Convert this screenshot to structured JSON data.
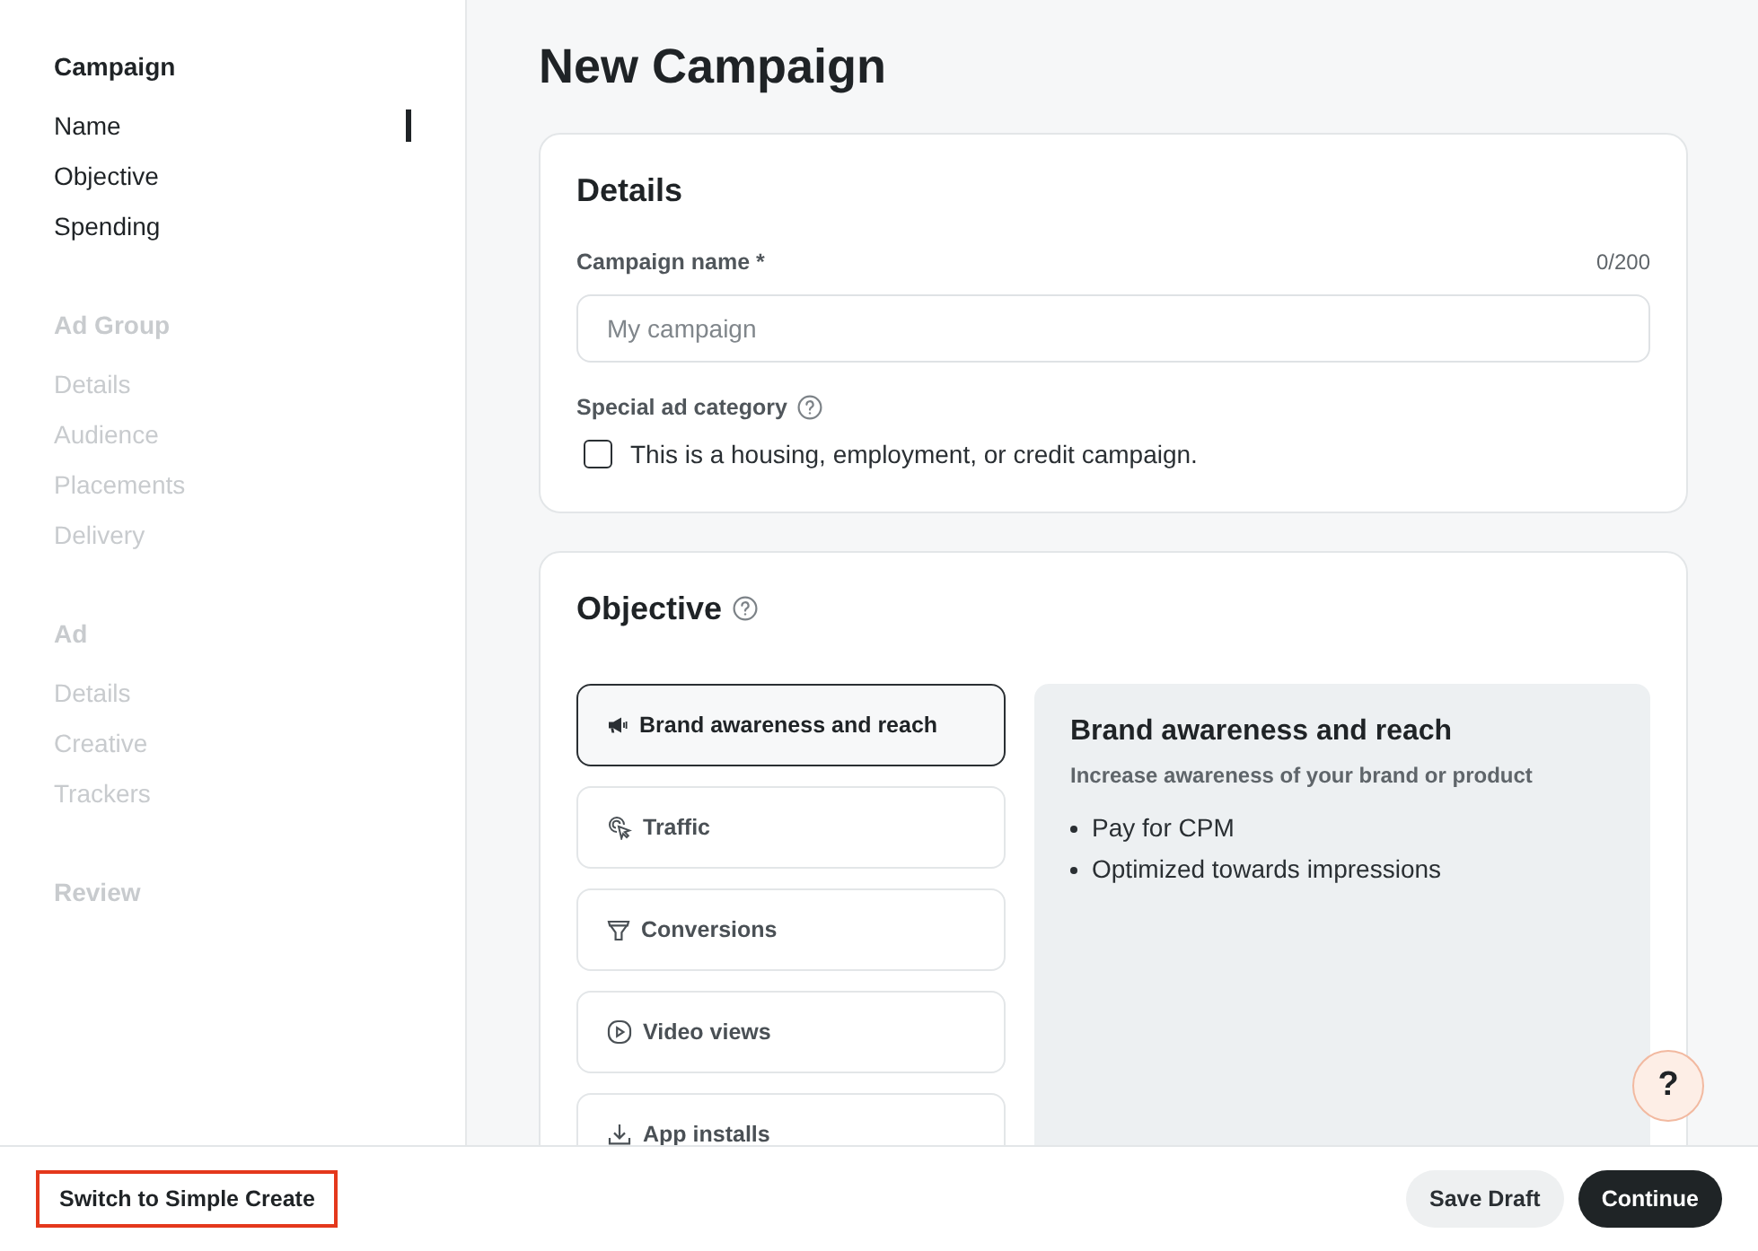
{
  "sidebar": {
    "sections": [
      {
        "title": "Campaign",
        "disabled": false,
        "items": [
          {
            "label": "Name",
            "selected": true
          },
          {
            "label": "Objective",
            "selected": false
          },
          {
            "label": "Spending",
            "selected": false
          }
        ]
      },
      {
        "title": "Ad Group",
        "disabled": true,
        "items": [
          {
            "label": "Details",
            "selected": false
          },
          {
            "label": "Audience",
            "selected": false
          },
          {
            "label": "Placements",
            "selected": false
          },
          {
            "label": "Delivery",
            "selected": false
          }
        ]
      },
      {
        "title": "Ad",
        "disabled": true,
        "items": [
          {
            "label": "Details",
            "selected": false
          },
          {
            "label": "Creative",
            "selected": false
          },
          {
            "label": "Trackers",
            "selected": false
          }
        ]
      },
      {
        "title": "Review",
        "disabled": true
      }
    ]
  },
  "page_title": "New Campaign",
  "details": {
    "title": "Details",
    "campaign_name": {
      "label": "Campaign name *",
      "counter": "0/200",
      "placeholder": "My campaign"
    },
    "special_ad_category": {
      "label": "Special ad category",
      "checkbox": {
        "label": "This is a housing, employment, or credit campaign.",
        "checked": false
      }
    }
  },
  "objective": {
    "title": "Objective",
    "options": [
      {
        "label": "Brand awareness and reach",
        "selected": true
      },
      {
        "label": "Traffic",
        "selected": false
      },
      {
        "label": "Conversions",
        "selected": false
      },
      {
        "label": "Video views",
        "selected": false
      },
      {
        "label": "App installs",
        "selected": false
      }
    ],
    "description": {
      "title": "Brand awareness and reach",
      "subtitle": "Increase awareness of your brand or product",
      "bullets": [
        "Pay for CPM",
        "Optimized towards impressions"
      ]
    }
  },
  "help_button": {
    "label": "?"
  },
  "footer": {
    "switch_button": {
      "label": "Switch to Simple Create",
      "highlighted": true
    },
    "buttons": [
      {
        "label": "Save Draft",
        "kind": "secondary"
      },
      {
        "label": "Continue",
        "kind": "primary"
      }
    ]
  }
}
